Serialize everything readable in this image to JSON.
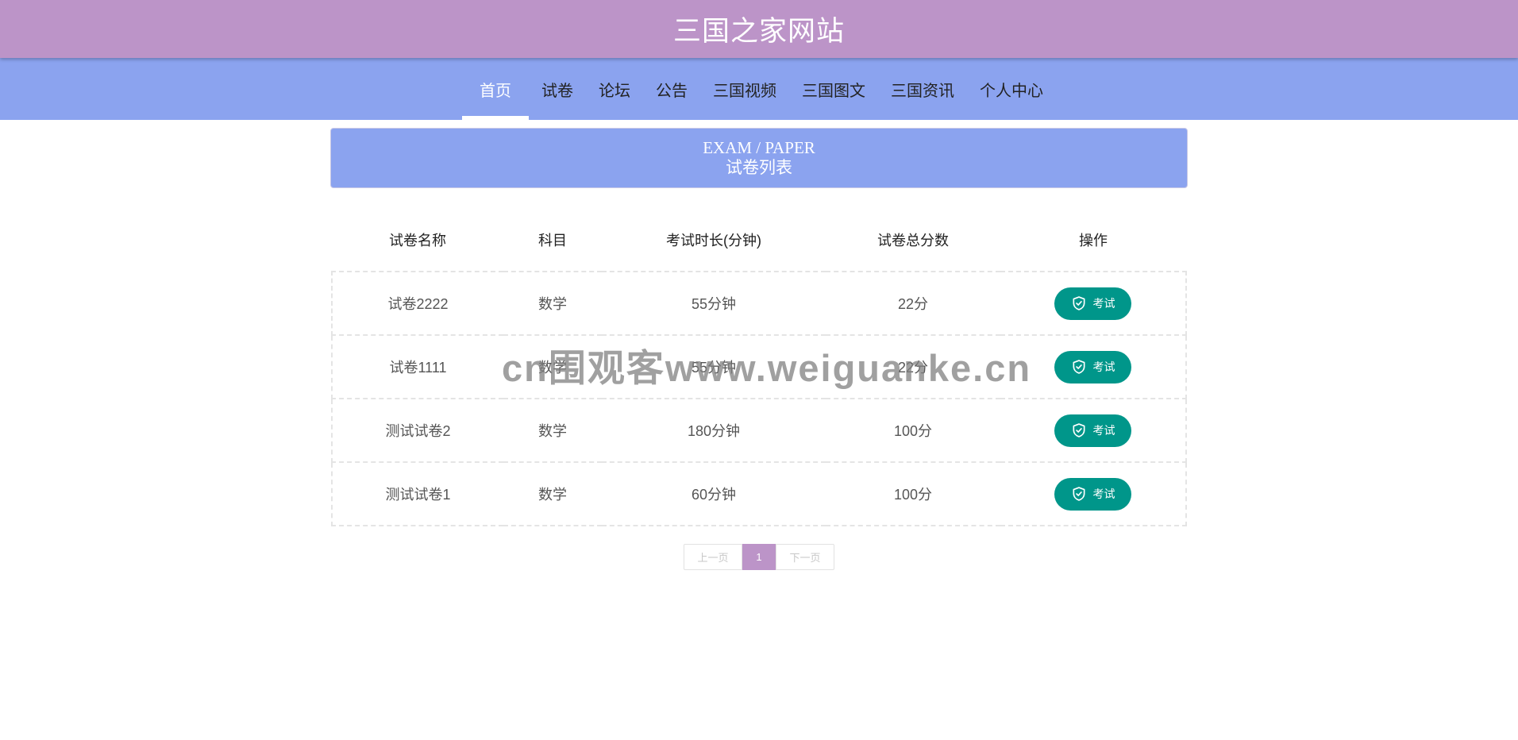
{
  "site": {
    "title": "三国之家网站"
  },
  "nav": {
    "items": [
      {
        "label": "首页",
        "active": true
      },
      {
        "label": "试卷"
      },
      {
        "label": "论坛"
      },
      {
        "label": "公告"
      },
      {
        "label": "三国视频"
      },
      {
        "label": "三国图文"
      },
      {
        "label": "三国资讯"
      },
      {
        "label": "个人中心"
      }
    ]
  },
  "banner": {
    "title": "EXAM / PAPER",
    "subtitle": "试卷列表"
  },
  "table": {
    "headers": [
      "试卷名称",
      "科目",
      "考试时长(分钟)",
      "试卷总分数",
      "操作"
    ],
    "rows": [
      {
        "name": "试卷2222",
        "subject": "数学",
        "duration": "55分钟",
        "score": "22分",
        "action": "考试"
      },
      {
        "name": "试卷1111",
        "subject": "数学",
        "duration": "55分钟",
        "score": "22分",
        "action": "考试"
      },
      {
        "name": "测试试卷2",
        "subject": "数学",
        "duration": "180分钟",
        "score": "100分",
        "action": "考试"
      },
      {
        "name": "测试试卷1",
        "subject": "数学",
        "duration": "60分钟",
        "score": "100分",
        "action": "考试"
      }
    ]
  },
  "pagination": {
    "prev": "上一页",
    "current": "1",
    "next": "下一页"
  },
  "watermark": "cn围观客www.weiguanke.cn",
  "colors": {
    "header": "#bc94c8",
    "nav": "#8ba3ef",
    "button": "#00968a"
  }
}
